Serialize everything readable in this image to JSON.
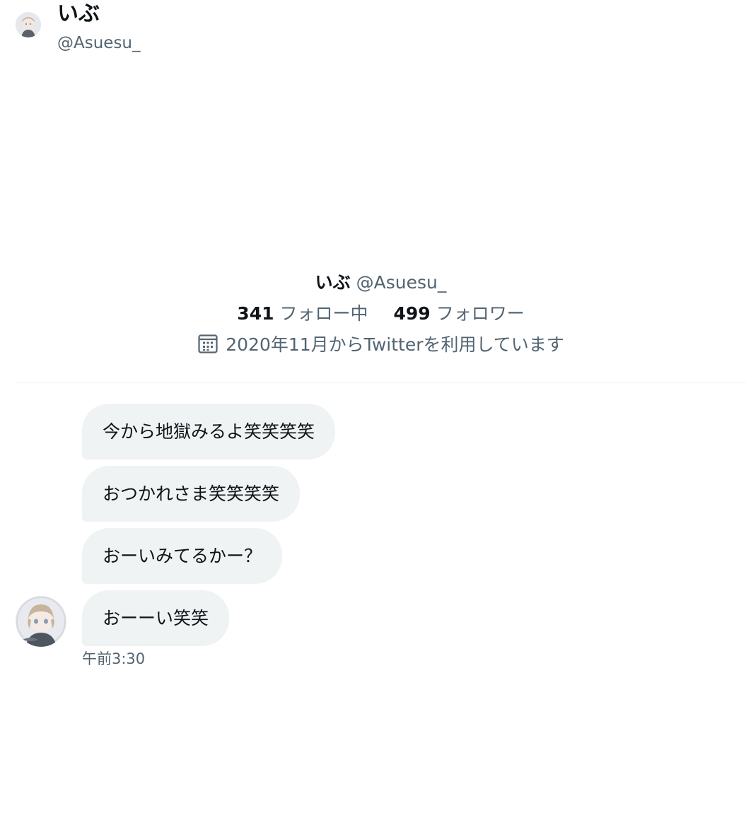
{
  "header": {
    "display_name": "いぶ",
    "handle": "@Asuesu_"
  },
  "profile": {
    "display_name": "いぶ",
    "handle": "@Asuesu_",
    "following_count": "341",
    "following_label": "フォロー中",
    "followers_count": "499",
    "followers_label": "フォロワー",
    "joined_text": "2020年11月からTwitterを利用しています",
    "joined_icon": "calendar-icon"
  },
  "messages": [
    {
      "text": "今から地獄みるよ笑笑笑笑"
    },
    {
      "text": "おつかれさま笑笑笑笑"
    },
    {
      "text": "おーいみてるかー？"
    },
    {
      "text": "おーーい笑笑"
    }
  ],
  "message_time": "午前3:30",
  "colors": {
    "bubble_bg": "#eff3f4",
    "text_primary": "#0f1419",
    "text_secondary": "#536471",
    "divider": "#eff3f4"
  }
}
